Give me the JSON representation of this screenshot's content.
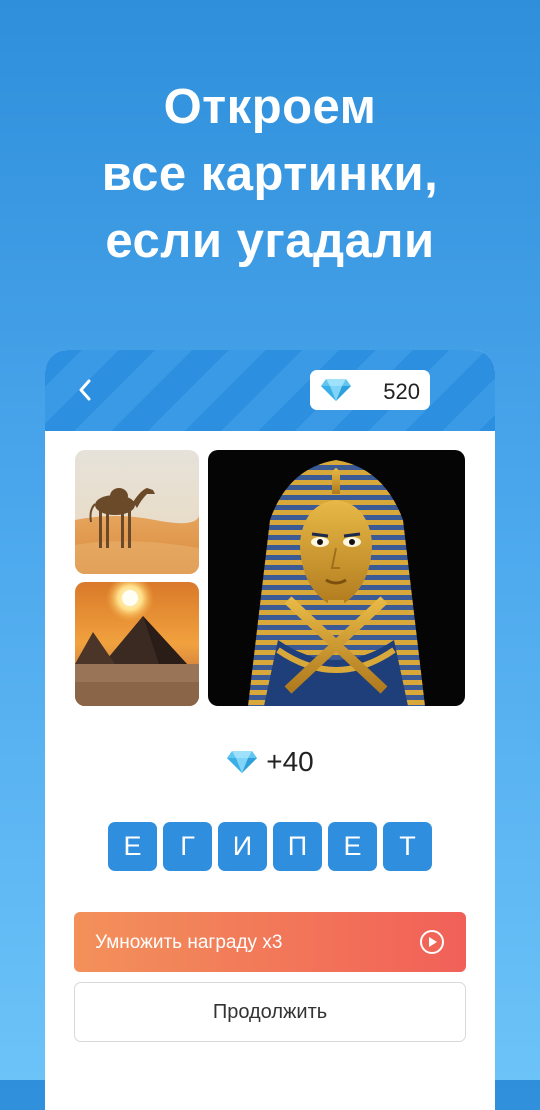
{
  "headline": {
    "line1": "Откроем",
    "line2": "все картинки,",
    "line3": "если угадали"
  },
  "header": {
    "back_icon": "chevron-left-icon",
    "gem_icon": "diamond-icon",
    "gem_count": "520"
  },
  "images": [
    {
      "subject": "camel in desert"
    },
    {
      "subject": "pyramids at sunset"
    },
    {
      "subject": "pharaoh golden mask"
    }
  ],
  "reward": {
    "icon": "diamond-icon",
    "amount": "+40"
  },
  "answer": {
    "letters": [
      "Е",
      "Г",
      "И",
      "П",
      "Е",
      "Т"
    ]
  },
  "buttons": {
    "multiply_label": "Умножить награду x3",
    "multiply_icon": "play-circle-icon",
    "continue_label": "Продолжить"
  },
  "colors": {
    "background_top": "#2f8fdb",
    "background_bottom": "#6cc3f8",
    "header": "#2c8fe0",
    "tile": "#2f8fde",
    "multiply_start": "#f3915a",
    "multiply_end": "#f16058"
  }
}
